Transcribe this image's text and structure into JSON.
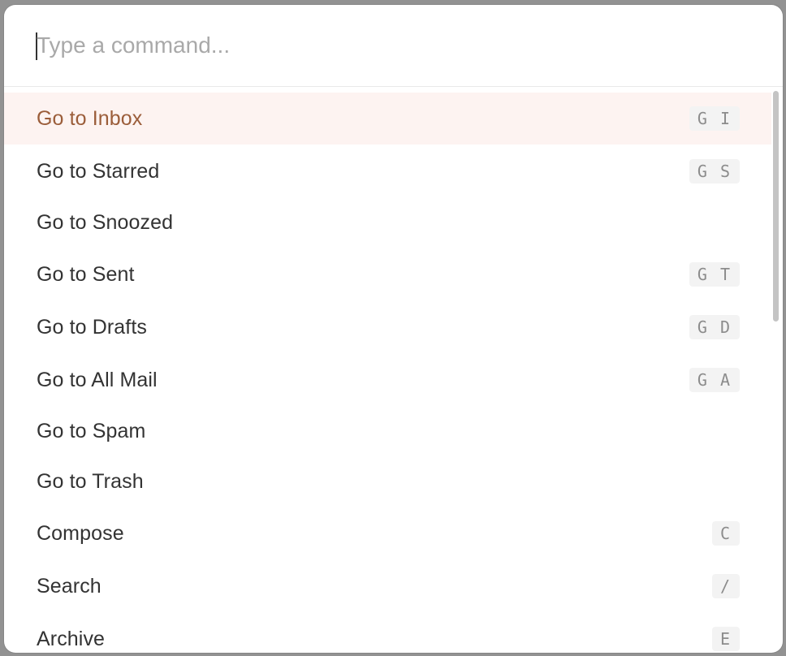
{
  "search": {
    "placeholder": "Type a command...",
    "value": ""
  },
  "commands": [
    {
      "label": "Go to Inbox",
      "keys": [
        "G",
        "I"
      ],
      "active": true
    },
    {
      "label": "Go to Starred",
      "keys": [
        "G",
        "S"
      ]
    },
    {
      "label": "Go to Snoozed",
      "keys": []
    },
    {
      "label": "Go to Sent",
      "keys": [
        "G",
        "T"
      ]
    },
    {
      "label": "Go to Drafts",
      "keys": [
        "G",
        "D"
      ]
    },
    {
      "label": "Go to All Mail",
      "keys": [
        "G",
        "A"
      ]
    },
    {
      "label": "Go to Spam",
      "keys": []
    },
    {
      "label": "Go to Trash",
      "keys": []
    },
    {
      "label": "Compose",
      "keys": [
        "C"
      ]
    },
    {
      "label": "Search",
      "keys": [
        "/"
      ]
    },
    {
      "label": "Archive",
      "keys": [
        "E"
      ]
    }
  ],
  "colors": {
    "active_background": "#fdf3f1",
    "active_text": "#9b5d3a",
    "text": "#333333",
    "placeholder": "#a9a9a9",
    "kbd_background": "#f3f3f3",
    "kbd_text": "#8c8c8c"
  }
}
